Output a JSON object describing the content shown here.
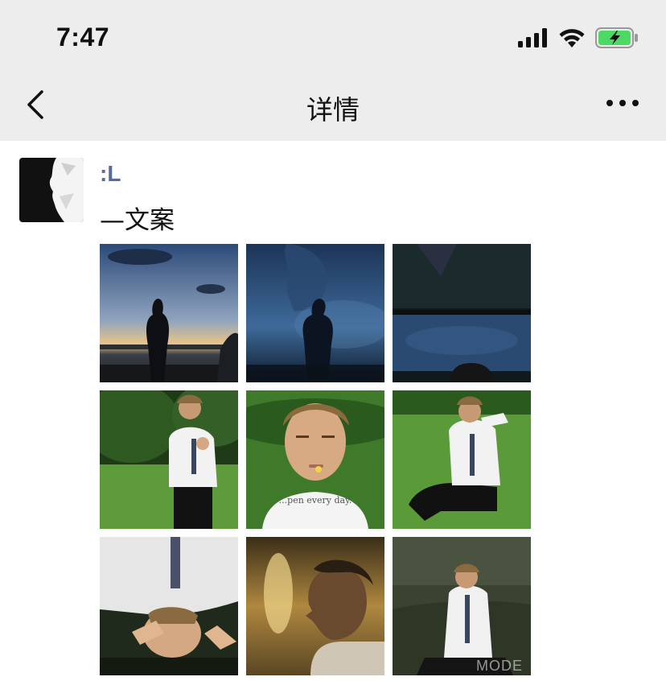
{
  "status_bar": {
    "time": "7:47",
    "icons": [
      "signal-icon",
      "wifi-icon",
      "battery-charging-icon"
    ],
    "battery_color": "#4cd964"
  },
  "nav": {
    "title": "详情",
    "back_icon": "chevron-left-icon",
    "more_icon": "more-icon"
  },
  "post": {
    "author": ":L",
    "caption": "—文案",
    "name_color": "#576b95",
    "photos": [
      {
        "overlay_text": ""
      },
      {
        "overlay_text": ""
      },
      {
        "overlay_text": ""
      },
      {
        "overlay_text": ""
      },
      {
        "overlay_text": "...pen every day."
      },
      {
        "overlay_text": ""
      },
      {
        "overlay_text": ""
      },
      {
        "overlay_text": ""
      },
      {
        "overlay_text": "MODE"
      }
    ]
  }
}
